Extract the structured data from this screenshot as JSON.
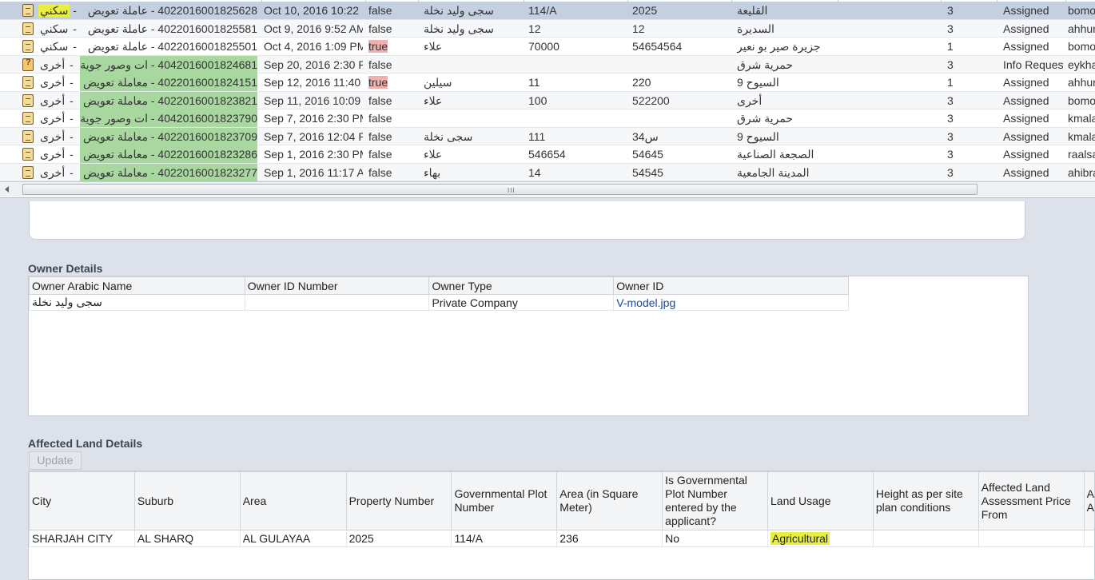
{
  "task_rows": [
    {
      "type": "سكني",
      "type_hl": "yellow",
      "task": "4022016001825628 - عاملة تعويض",
      "task_hl": "",
      "date": "Oct 10, 2016 10:22",
      "flag": "false",
      "flag_hl": "",
      "owner": "سجى وليد نخلة",
      "plot": "114/A",
      "prop": "2025",
      "area": "القليعة",
      "level": "3",
      "status": "Assigned",
      "user": "bomo",
      "selected": true,
      "info": false
    },
    {
      "type": "سكني",
      "type_hl": "",
      "task": "4022016001825581 - عاملة تعويض",
      "task_hl": "",
      "date": "Oct 9, 2016 9:52 AM",
      "flag": "false",
      "flag_hl": "",
      "owner": "سجى وليد نخلة",
      "plot": "12",
      "prop": "12",
      "area": "السديرة",
      "level": "3",
      "status": "Assigned",
      "user": "ahhur",
      "selected": false,
      "info": false
    },
    {
      "type": "سكني",
      "type_hl": "",
      "task": "4022016001825501 - عاملة تعويض",
      "task_hl": "",
      "date": "Oct 4, 2016 1:09 PM",
      "flag": "true",
      "flag_hl": "pink",
      "owner": "علاء",
      "plot": "70000",
      "prop": "54654564",
      "area": "جزيرة صير بو نعير",
      "level": "1",
      "status": "Assigned",
      "user": "bomo",
      "selected": false,
      "info": false
    },
    {
      "type": "أخرى",
      "type_hl": "",
      "task": "4042016001824681 - ات وصور جوية",
      "task_hl": "green",
      "date": "Sep 20, 2016 2:30 P",
      "flag": "false",
      "flag_hl": "",
      "owner": "",
      "plot": "",
      "prop": "",
      "area": "حمرية شرق",
      "level": "3",
      "status": "Info Request",
      "user": "eykha",
      "selected": false,
      "info": true
    },
    {
      "type": "أخرى",
      "type_hl": "",
      "task": "4022016001824151 - معاملة تعويض",
      "task_hl": "green",
      "date": "Sep 12, 2016 11:40",
      "flag": "true",
      "flag_hl": "pink",
      "owner": "سيلين",
      "plot": "11",
      "prop": "220",
      "area": "السيوح 9",
      "level": "1",
      "status": "Assigned",
      "user": "ahhur",
      "selected": false,
      "info": false
    },
    {
      "type": "أخرى",
      "type_hl": "",
      "task": "4022016001823821 - معاملة تعويض",
      "task_hl": "green",
      "date": "Sep 11, 2016 10:09",
      "flag": "false",
      "flag_hl": "",
      "owner": "علاء",
      "plot": "100",
      "prop": "522200",
      "area": "أخرى",
      "level": "3",
      "status": "Assigned",
      "user": "bomo",
      "selected": false,
      "info": false
    },
    {
      "type": "أخرى",
      "type_hl": "",
      "task": "4042016001823790 - ات وصور جوية",
      "task_hl": "green",
      "date": "Sep 7, 2016 2:30 PM",
      "flag": "false",
      "flag_hl": "",
      "owner": "",
      "plot": "",
      "prop": "",
      "area": "حمرية شرق",
      "level": "3",
      "status": "Assigned",
      "user": "kmala",
      "selected": false,
      "info": false
    },
    {
      "type": "أخرى",
      "type_hl": "",
      "task": "4022016001823709 - معاملة تعويض",
      "task_hl": "green",
      "date": "Sep 7, 2016 12:04 P",
      "flag": "false",
      "flag_hl": "",
      "owner": "سجى نخلة",
      "plot": "111",
      "prop": "س34",
      "area": "السيوح 9",
      "level": "3",
      "status": "Assigned",
      "user": "kmala",
      "selected": false,
      "info": false
    },
    {
      "type": "أخرى",
      "type_hl": "",
      "task": "4022016001823286 - معاملة تعويض",
      "task_hl": "green",
      "date": "Sep 1, 2016 2:30 PM",
      "flag": "false",
      "flag_hl": "",
      "owner": "علاء",
      "plot": "546654",
      "prop": "54645",
      "area": "الصجعة الصناعية",
      "level": "3",
      "status": "Assigned",
      "user": "raalsa",
      "selected": false,
      "info": false
    },
    {
      "type": "أخرى",
      "type_hl": "",
      "task": "4022016001823277 - معاملة تعويض",
      "task_hl": "green",
      "date": "Sep 1, 2016 11:17 A",
      "flag": "false",
      "flag_hl": "",
      "owner": "بهاء",
      "plot": "14",
      "prop": "54545",
      "area": "المدينة الجامعية",
      "level": "3",
      "status": "Assigned",
      "user": "ahibra",
      "selected": false,
      "info": false
    }
  ],
  "scrollbar": {
    "grip": "III"
  },
  "owner_details": {
    "title": "Owner Details",
    "headers": [
      "Owner Arabic Name",
      "Owner ID Number",
      "Owner Type",
      "Owner ID"
    ],
    "row": {
      "arabic_name": "سجى وليد نخلة",
      "id_number": "",
      "type": "Private Company",
      "owner_id": "V-model.jpg"
    }
  },
  "affected_land": {
    "title": "Affected Land Details",
    "update_label": "Update",
    "headers": [
      "City",
      "Suburb",
      "Area",
      "Property Number",
      "Governmental Plot Number",
      "Area (in Square Meter)",
      "Is Governmental Plot Number entered by the applicant?",
      "Land Usage",
      "Height as per site plan conditions",
      "Affected Land Assessment Price From",
      "Affe Asse"
    ],
    "row": {
      "city": "SHARJAH CITY",
      "suburb": "AL SHARQ",
      "area": "AL GULAYAA",
      "property_number": "2025",
      "plot_number": "114/A",
      "area_sqm": "236",
      "entered_by_applicant": "No",
      "land_usage": "Agricultural",
      "height": "",
      "price_from": "",
      "price_to": ""
    }
  },
  "colors": {
    "highlight_yellow": "#e8ef40",
    "highlight_green": "#a8d8a0",
    "highlight_pink": "#f0b0b0",
    "selected_row": "#c4cfe0"
  }
}
